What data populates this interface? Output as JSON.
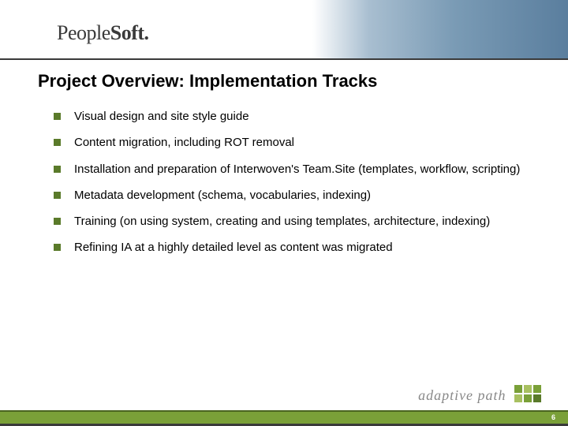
{
  "header": {
    "logo_thin": "People",
    "logo_bold": "Soft."
  },
  "title": "Project Overview: Implementation Tracks",
  "bullets": [
    "Visual design and site style guide",
    "Content migration, including ROT removal",
    "Installation and preparation of Interwoven's Team.Site (templates, workflow, scripting)",
    "Metadata development (schema, vocabularies, indexing)",
    "Training (on using system, creating and using templates, architecture, indexing)",
    "Refining IA at a highly detailed level as content was migrated"
  ],
  "footer": {
    "brand": "adaptive path",
    "page_number": "6"
  }
}
